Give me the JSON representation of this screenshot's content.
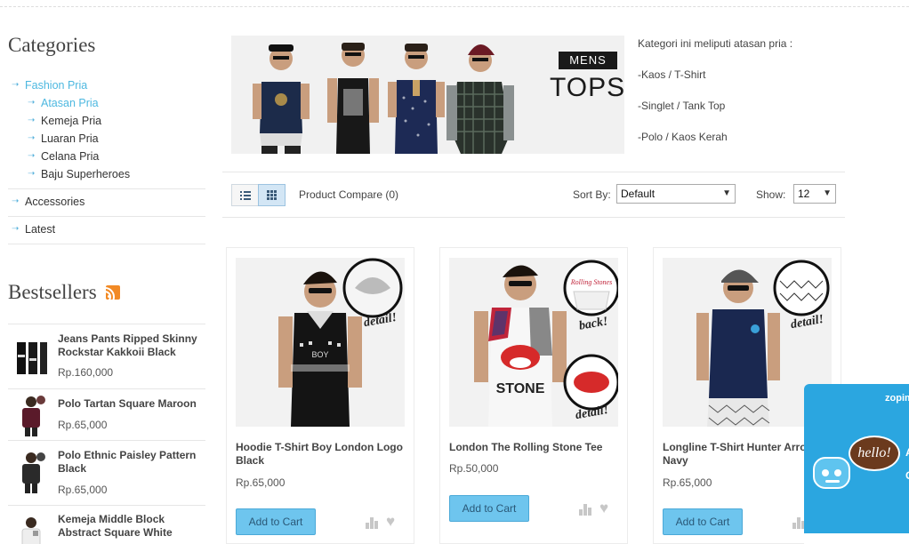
{
  "sidebar": {
    "categories_heading": "Categories",
    "categories": [
      {
        "label": "Fashion Pria",
        "level": 0,
        "active": true
      },
      {
        "label": "Atasan Pria",
        "level": 1,
        "active": true
      },
      {
        "label": "Kemeja Pria",
        "level": 1,
        "active": false
      },
      {
        "label": "Luaran Pria",
        "level": 1,
        "active": false
      },
      {
        "label": "Celana Pria",
        "level": 1,
        "active": false
      },
      {
        "label": "Baju Superheroes",
        "level": 1,
        "active": false
      },
      {
        "label": "Accessories",
        "level": 0,
        "active": false
      },
      {
        "label": "Latest",
        "level": 0,
        "active": false
      }
    ],
    "bestsellers_heading": "Bestsellers",
    "bestsellers": [
      {
        "name": "Jeans Pants Ripped Skinny Rockstar Kakkoii Black",
        "price": "Rp.160,000"
      },
      {
        "name": "Polo Tartan Square Maroon",
        "price": "Rp.65,000"
      },
      {
        "name": "Polo Ethnic Paisley Pattern Black",
        "price": "Rp.65,000"
      },
      {
        "name": "Kemeja Middle Block Abstract Square White",
        "price": ""
      }
    ]
  },
  "banner": {
    "badge": "MENS",
    "title": "TOPS"
  },
  "description": {
    "intro": "Kategori ini meliputi atasan pria :",
    "items": [
      "-Kaos / T-Shirt",
      "-Singlet / Tank Top",
      "-Polo / Kaos Kerah"
    ]
  },
  "toolbar": {
    "compare_label": "Product Compare (0)",
    "sort_label": "Sort By:",
    "sort_value": "Default",
    "show_label": "Show:",
    "show_value": "12"
  },
  "products": [
    {
      "name": "Hoodie T-Shirt Boy London Logo Black",
      "price": "Rp.65,000",
      "detail_badge": "detail!",
      "cart_label": "Add to Cart"
    },
    {
      "name": "London The Rolling Stone Tee",
      "price": "Rp.50,000",
      "detail_badge": "detail!",
      "back_badge": "back!",
      "cart_label": "Add to Cart"
    },
    {
      "name": "Longline T-Shirt Hunter Arrow Navy",
      "price": "Rp.65,000",
      "detail_badge": "detail!",
      "cart_label": "Add to Cart"
    }
  ],
  "chat": {
    "brand": "zopim",
    "greeting": "hello!",
    "partial_text": [
      "A",
      "C"
    ]
  },
  "colors": {
    "accent": "#4db8e0",
    "button": "#6ec5ee",
    "chat": "#2ba6e0",
    "rss": "#f28a25"
  }
}
